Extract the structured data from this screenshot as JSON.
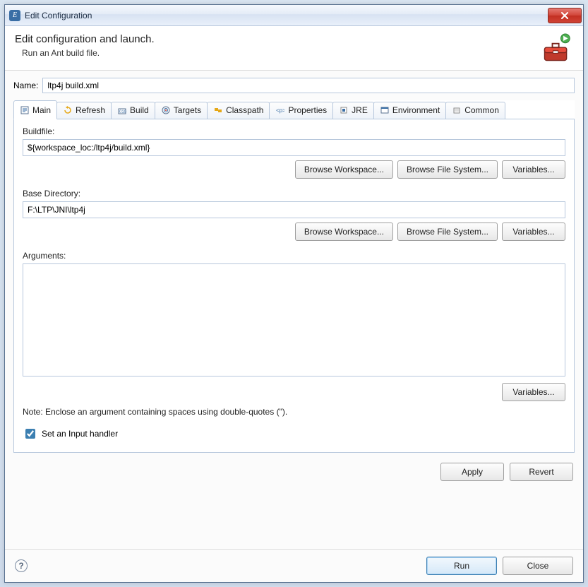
{
  "window": {
    "title": "Edit Configuration"
  },
  "header": {
    "title": "Edit configuration and launch.",
    "subtitle": "Run an Ant build file."
  },
  "name": {
    "label": "Name:",
    "value": "ltp4j build.xml"
  },
  "tabs": [
    {
      "label": "Main",
      "icon": "main"
    },
    {
      "label": "Refresh",
      "icon": "refresh"
    },
    {
      "label": "Build",
      "icon": "build"
    },
    {
      "label": "Targets",
      "icon": "targets"
    },
    {
      "label": "Classpath",
      "icon": "classpath"
    },
    {
      "label": "Properties",
      "icon": "properties"
    },
    {
      "label": "JRE",
      "icon": "jre"
    },
    {
      "label": "Environment",
      "icon": "environment"
    },
    {
      "label": "Common",
      "icon": "common"
    }
  ],
  "main": {
    "buildfile": {
      "label": "Buildfile:",
      "value": "${workspace_loc:/ltp4j/build.xml}",
      "browse_ws": "Browse Workspace...",
      "browse_fs": "Browse File System...",
      "variables": "Variables..."
    },
    "basedir": {
      "label": "Base Directory:",
      "value": "F:\\LTP\\JNI\\ltp4j",
      "browse_ws": "Browse Workspace...",
      "browse_fs": "Browse File System...",
      "variables": "Variables..."
    },
    "arguments": {
      "label": "Arguments:",
      "value": "",
      "variables": "Variables...",
      "note": "Note: Enclose an argument containing spaces using double-quotes (\")."
    },
    "input_handler": {
      "label": "Set an Input handler",
      "checked": true
    }
  },
  "actions": {
    "apply": "Apply",
    "revert": "Revert"
  },
  "footer": {
    "run": "Run",
    "close": "Close"
  }
}
